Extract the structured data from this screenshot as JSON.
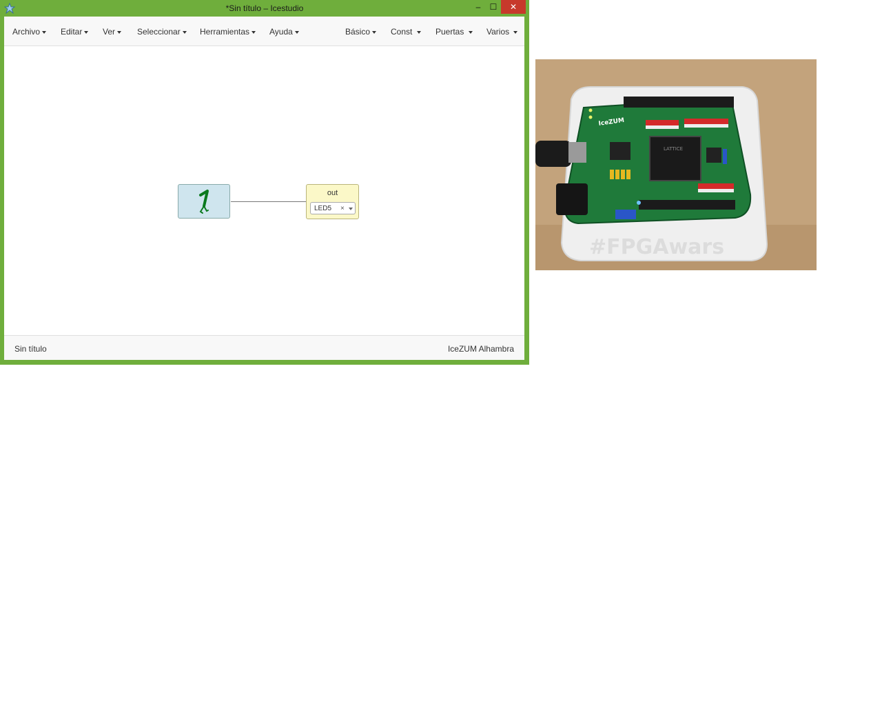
{
  "window": {
    "title": "*Sin título – Icestudio",
    "controls": {
      "minimize": "–",
      "maximize": "☐",
      "close": "✕"
    }
  },
  "menubar": {
    "left_items": [
      {
        "label": "Archivo"
      },
      {
        "label": "Editar"
      },
      {
        "label": "Ver"
      },
      {
        "label": "Seleccionar"
      },
      {
        "label": "Herramientas"
      },
      {
        "label": "Ayuda"
      }
    ],
    "right_items": [
      {
        "label": "Básico"
      },
      {
        "label": "Const"
      },
      {
        "label": "Puertas"
      },
      {
        "label": "Varios"
      }
    ]
  },
  "canvas": {
    "const_block": {
      "icon": "bit-one-icon"
    },
    "output_block": {
      "label": "out",
      "selected_pin": "LED5",
      "clear_symbol": "×"
    }
  },
  "statusbar": {
    "project_name": "Sin título",
    "board_name": "IceZUM Alhambra"
  },
  "photo": {
    "board_label": "IceZUM",
    "watermark": "#FPGAwars",
    "colors": {
      "table": "#c2a27a",
      "pcb": "#1f7a3a",
      "case": "#efefef"
    }
  }
}
